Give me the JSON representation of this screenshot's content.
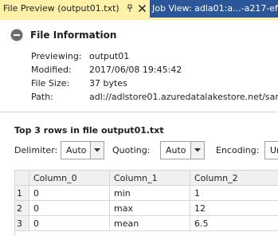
{
  "tabs": {
    "active_label": "File Preview (output01.txt)",
    "inactive_label": "Job View: adla01:a...-a217-ef52"
  },
  "file_info": {
    "title": "File Information",
    "fields": [
      {
        "label": "Previewing:",
        "value": "output01"
      },
      {
        "label": "Modified:",
        "value": "2017/06/08 19:45:42"
      },
      {
        "label": "File Size:",
        "value": "37 bytes"
      },
      {
        "label": "Path:",
        "value": "adl://adlstore01.azuredatalakestore.net/samp"
      }
    ]
  },
  "preview": {
    "title": "Top 3 rows in file output01.txt",
    "delimiter_label": "Delimiter:",
    "delimiter_value": "Auto",
    "quoting_label": "Quoting:",
    "quoting_value": "Auto",
    "encoding_label": "Encoding:",
    "encoding_value": "Ur"
  },
  "grid": {
    "columns": [
      "Column_0",
      "Column_1",
      "Column_2"
    ],
    "rows": [
      {
        "num": "1",
        "cells": [
          "0",
          "min",
          "1"
        ]
      },
      {
        "num": "2",
        "cells": [
          "0",
          "max",
          "12"
        ]
      },
      {
        "num": "3",
        "cells": [
          "0",
          "mean",
          "6.5"
        ]
      }
    ]
  }
}
